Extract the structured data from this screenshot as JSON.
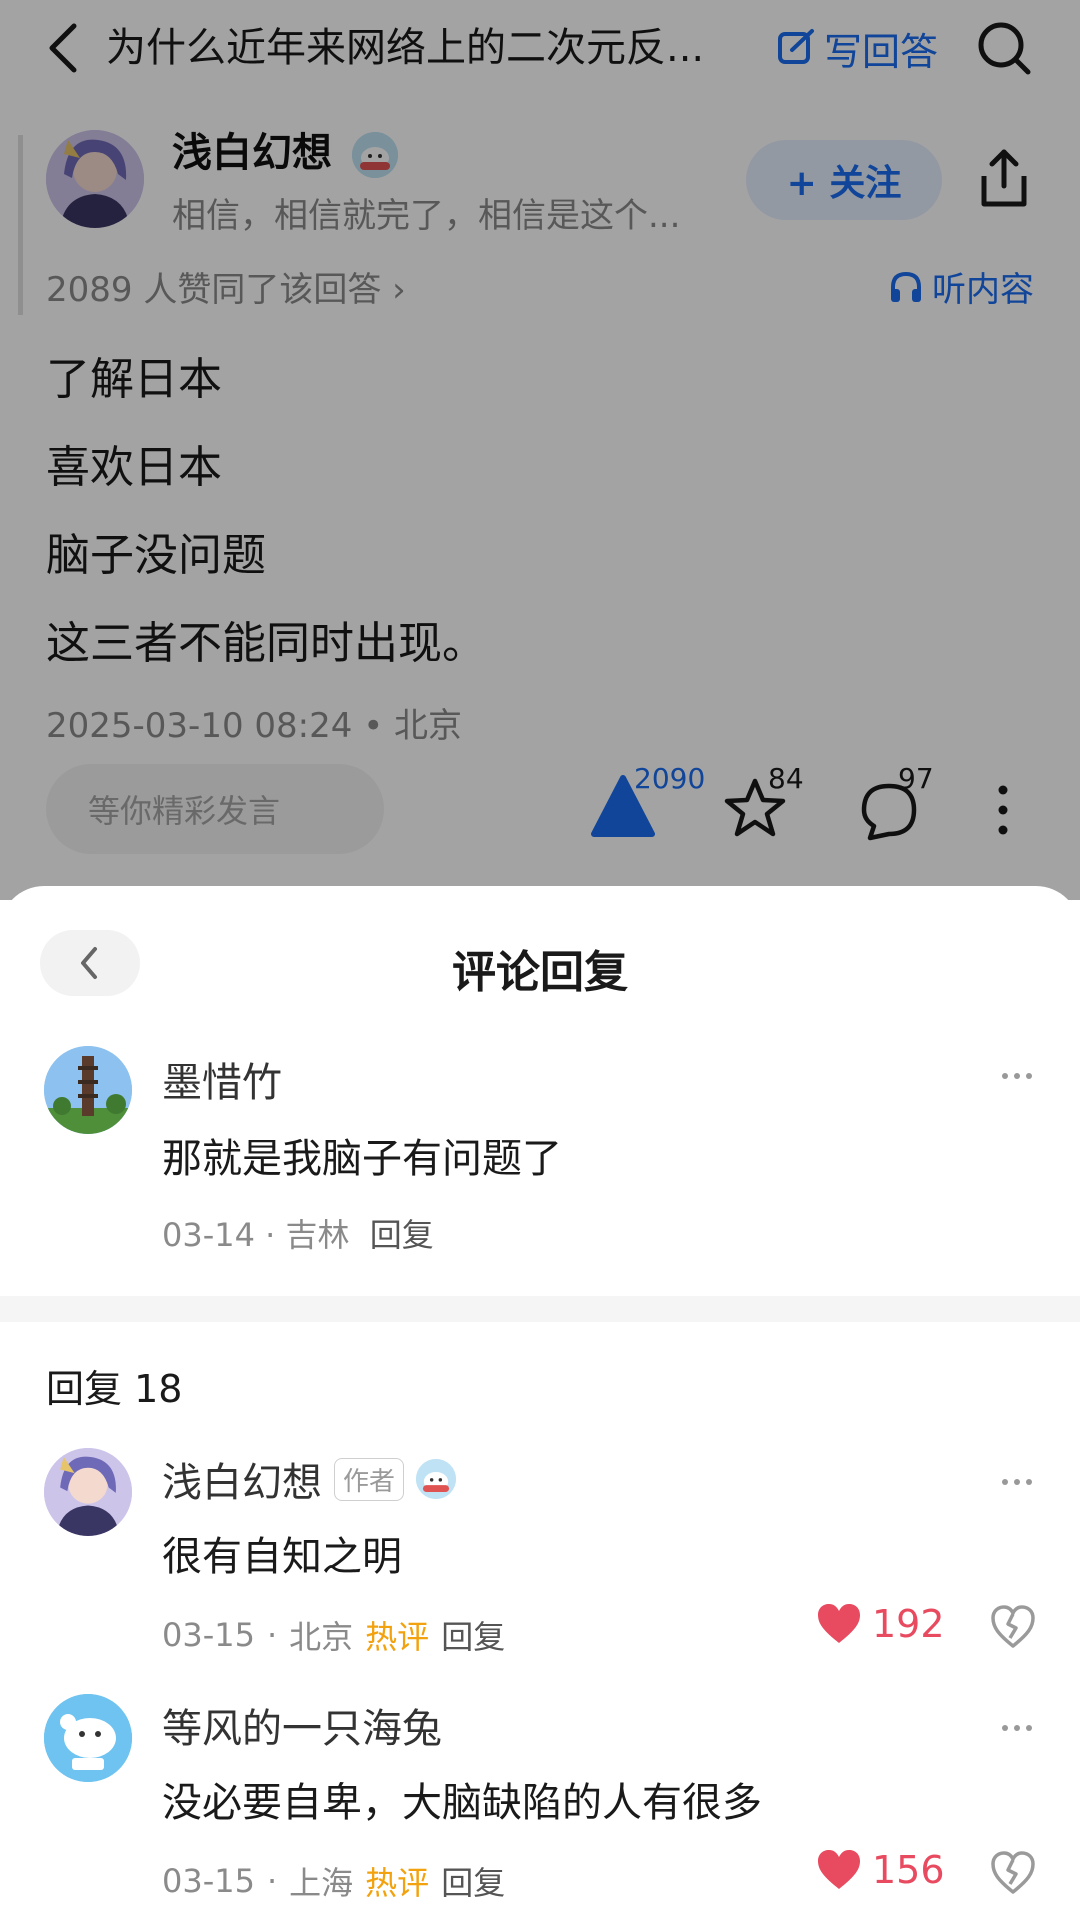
{
  "colors": {
    "accent": "#1a6cf0",
    "like": "#e84a5f",
    "hot": "#f2a20e",
    "muted": "#8a8a8a"
  },
  "topbar": {
    "question_title": "为什么近年来网络上的二次元反...",
    "write_answer_label": "写回答",
    "icons": [
      "chevron-left-icon",
      "edit-icon",
      "search-icon"
    ]
  },
  "answer": {
    "author_name": "浅白幻想",
    "author_bio": "相信，相信就完了，相信是这个...",
    "follow_label": "+ 关注",
    "agree_text": "2089 人赞同了该回答 ›",
    "listen_label": "听内容",
    "lines": [
      "了解日本",
      "喜欢日本",
      "脑子没问题",
      "这三者不能同时出现。"
    ],
    "meta": "2025-03-10 08:24 • 北京",
    "input_placeholder": "等你精彩发言",
    "vote_count": "2090",
    "favorite_count": "84",
    "comment_count": "97"
  },
  "sheet": {
    "title": "评论回复",
    "root_comment": {
      "name": "墨惜竹",
      "text": "那就是我脑子有问题了",
      "date": "03-14",
      "location": "吉林",
      "reply_label": "回复"
    },
    "reply_count_label": "回复 18",
    "replies": [
      {
        "name": "浅白幻想",
        "author_tag": "作者",
        "text": "很有自知之明",
        "date": "03-15",
        "location": "北京",
        "hot_label": "热评",
        "reply_label": "回复",
        "likes": "192"
      },
      {
        "name": "等风的一只海兔",
        "text": "没必要自卑，大脑缺陷的人有很多",
        "date": "03-15",
        "location": "上海",
        "hot_label": "热评",
        "reply_label": "回复",
        "likes": "156"
      }
    ]
  }
}
